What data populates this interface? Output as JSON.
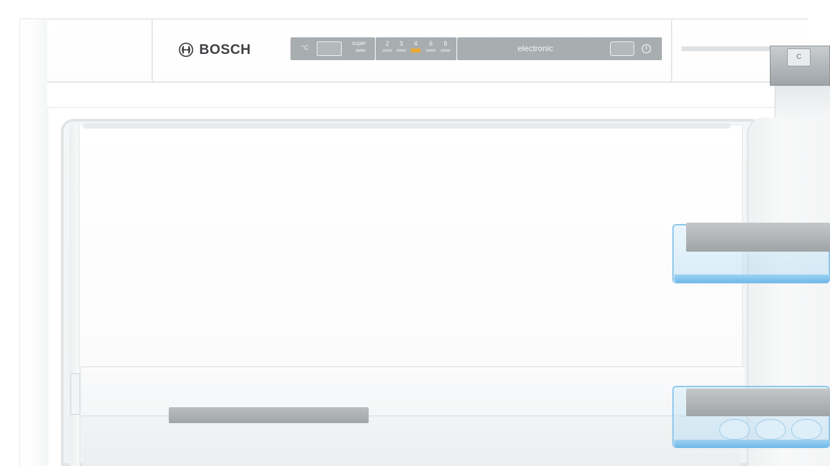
{
  "brand": {
    "name": "BOSCH",
    "logo_icon": "bosch-armature-icon"
  },
  "control_panel": {
    "unit_label": "°C",
    "super_label": "super",
    "levels": [
      {
        "label": "2",
        "active": false
      },
      {
        "label": "3",
        "active": false
      },
      {
        "label": "4",
        "active": true
      },
      {
        "label": "6",
        "active": false
      },
      {
        "label": "8",
        "active": false
      }
    ],
    "mode_label": "electronic",
    "power_icon": "power-icon",
    "active_color": "#e6a93a"
  },
  "hinge": {
    "cap_label": "C"
  },
  "colors": {
    "panel_gray": "#a8adb0",
    "shelf_blue": "#8fc7ec",
    "handle_gray": "#a0a5a8"
  }
}
